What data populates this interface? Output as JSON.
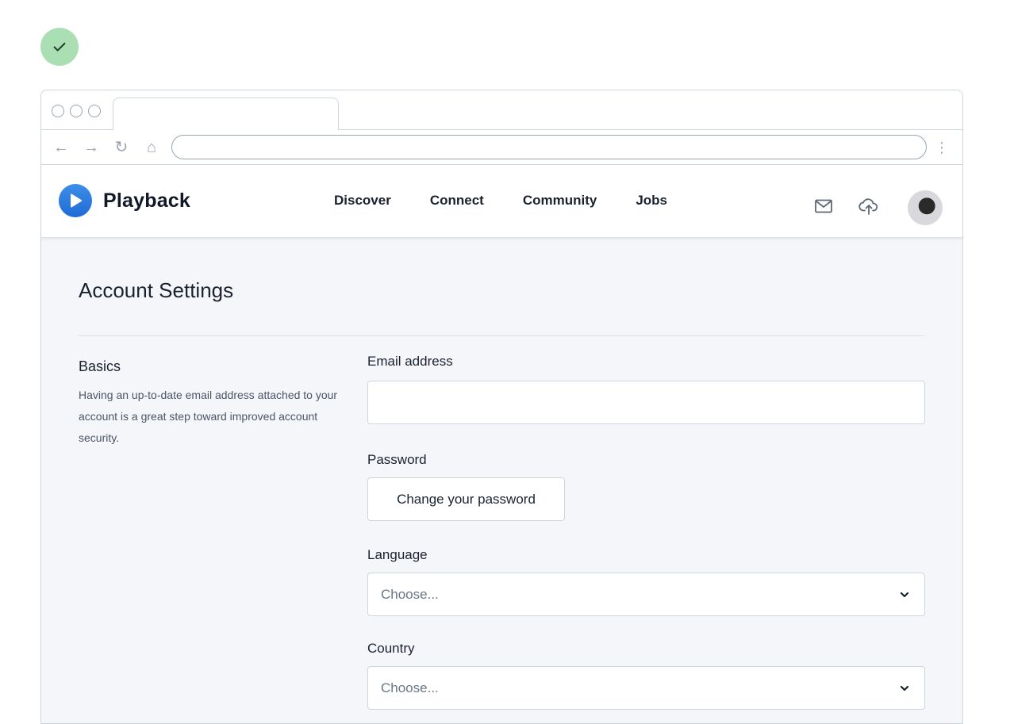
{
  "app": {
    "brand": "Playback",
    "nav": [
      "Discover",
      "Connect",
      "Community",
      "Jobs"
    ]
  },
  "page": {
    "title": "Account Settings"
  },
  "basics": {
    "heading": "Basics",
    "description": "Having an up-to-date email address attached to your account is a great step toward improved account security."
  },
  "form": {
    "email_label": "Email address",
    "email_value": "",
    "password_label": "Password",
    "password_button": "Change your password",
    "language_label": "Language",
    "language_value": "Choose...",
    "country_label": "Country",
    "country_value": "Choose..."
  },
  "icons": {
    "status": "check-icon",
    "mail": "mail-icon",
    "upload": "upload-icon"
  },
  "colors": {
    "brand": "#2b7de0",
    "success_bg": "#a9dfb3",
    "page_bg": "#f5f6f9"
  }
}
